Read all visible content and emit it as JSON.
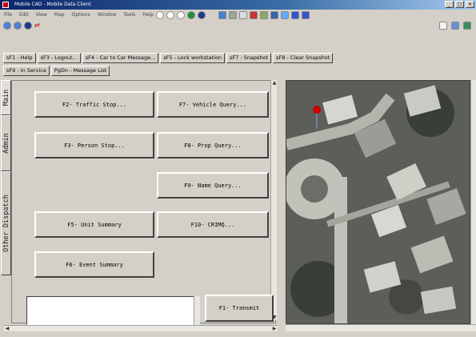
{
  "title_bar": {
    "title": "Mobile CAD - Mobile Data Client"
  },
  "menu": [
    "File",
    "Edit",
    "View",
    "Map",
    "Options",
    "Window",
    "Tools",
    "Help"
  ],
  "function_keys_row1": [
    "sF1 - Help",
    "sF3 - Logout...",
    "sF4 - Car to Car Message...",
    "sF5 - Lock workstation",
    "sF7 - Snapshot",
    "sF8 - Clear Snapshot"
  ],
  "function_keys_row2": [
    "sF9 - In Service",
    "PgDn - Message List"
  ],
  "tabs": [
    "Main",
    "Admin",
    "Other Dispatch"
  ],
  "commands": {
    "traffic_stop": "F2- Traffic Stop...",
    "vehicle_query": "F7- Vehicle Query...",
    "person_stop": "F3- Person Stop...",
    "prop_query": "F8- Prop Query...",
    "name_query": "F9- Name Query...",
    "unit_summary": "F5- Unit Summary",
    "crimq": "F10- CRIMQ...",
    "event_summary": "F6- Event Summary",
    "transmit": "F1- Transmit"
  },
  "icons": {
    "toolbar": [
      "back-icon",
      "forward-icon",
      "globe-icon",
      "sync-icon",
      "refresh-icon",
      "zoom-in-icon",
      "zoom-out-icon",
      "map-layer-icon",
      "gps-icon",
      "pointer-icon",
      "select-icon",
      "identify-icon",
      "measure-icon",
      "layers-icon",
      "pan-icon",
      "zoom-extent-icon",
      "zoom-box-icon",
      "zoom-prev-icon",
      "zoom-next-icon"
    ],
    "right": [
      "edit-icon",
      "print-icon",
      "exit-icon"
    ]
  },
  "colors": {
    "title_bar": "#0a246a",
    "button_face": "#d4d0c8",
    "map_marker": "#cc0000"
  }
}
